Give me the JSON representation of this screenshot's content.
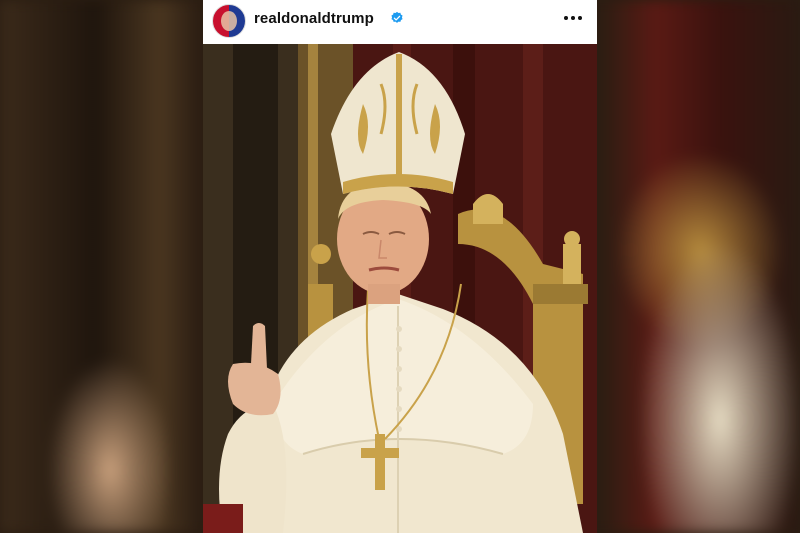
{
  "post": {
    "username": "realdonaldtrump",
    "verified": true,
    "avatar_icon": "profile-avatar",
    "more_icon": "more-horizontal-icon",
    "photo_icon": "post-photo"
  },
  "colors": {
    "verified_blue": "#1d9bf0",
    "vestment": "#f3ead5",
    "gold": "#c9a24a"
  }
}
